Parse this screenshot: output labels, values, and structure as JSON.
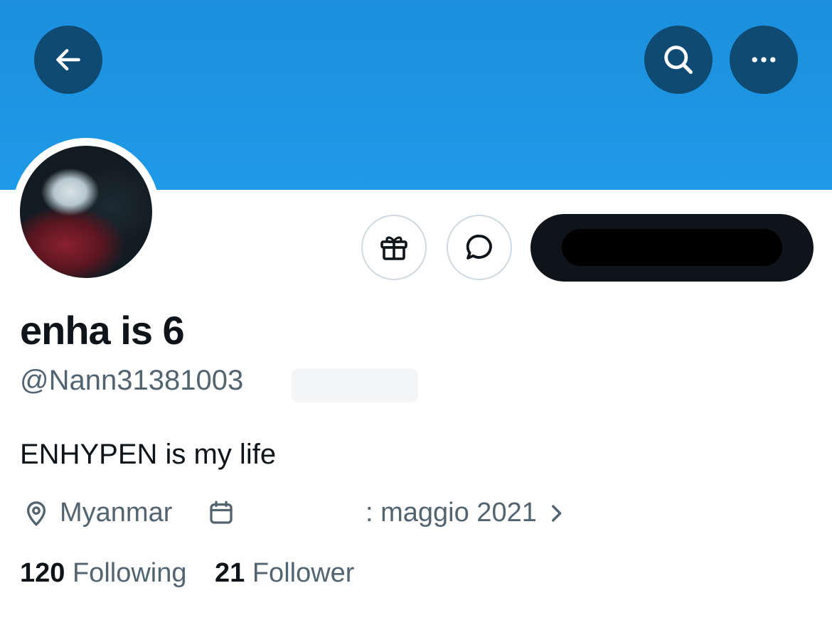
{
  "header": {
    "back_icon": "arrow-left-icon",
    "search_icon": "search-icon",
    "more_icon": "more-horizontal-icon",
    "banner_color": "#1d9bf0"
  },
  "profile_actions": {
    "gift_icon": "gift-icon",
    "message_icon": "message-bubble-icon",
    "follow_button_label": ""
  },
  "profile": {
    "display_name": "enha is 6",
    "handle": "@Nann31381003",
    "bio": "ENHYPEN is my life",
    "location": "Myanmar",
    "joined": ": maggio 2021",
    "following_count": "120",
    "following_label": "Following",
    "followers_count": "21",
    "followers_label": "Follower"
  }
}
